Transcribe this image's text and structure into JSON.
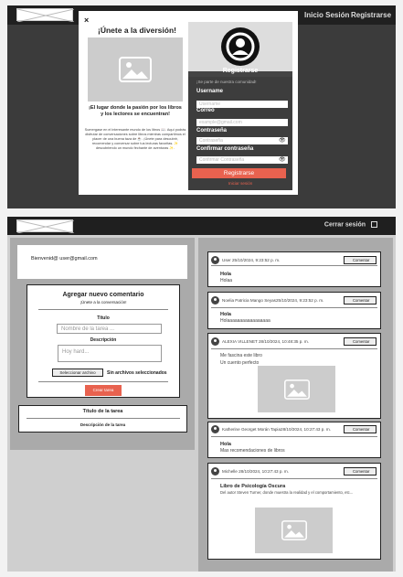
{
  "nav": {
    "login": "Inicio Sesión",
    "register": "Registrarse",
    "logout": "Cerrar sesión"
  },
  "modal": {
    "close": "×",
    "title": "¡Únete a la diversión!",
    "subtitle": "¡El lugar donde la pasión por los libros y los lectores se encuentran!",
    "description": "Sumergase en el interesante mundo de los libros 📖. Aquí podrás disfrutar de conversaciones sobre libros mientras compartimos el placer de una buena taza de ☕. ¡Únete para descubrir, recomendar y conversar sobre tus lecturas favoritas. ✨ descubriendo un mundo fechante de aventuras ✨."
  },
  "register": {
    "title": "Registrarse",
    "subtitle": "¡Se parte de nuestra comunidad!",
    "user_label": "Username",
    "user_placeholder": "Username",
    "email_label": "Correo",
    "email_placeholder": "example@gmail.com",
    "pass_label": "Contraseña",
    "pass_placeholder": "Contraseña",
    "confirm_label": "Confirmar contraseña",
    "confirm_placeholder": "Confirmar Contraseña",
    "submit": "Registrarse",
    "login_link": "Iniciar sesión"
  },
  "welcome": "Bienvenid@ user@gmail.com",
  "new_comment": {
    "title": "Agregar nuevo comentario",
    "subtitle": "¡Únete a la conversación!",
    "title_label": "Título",
    "title_placeholder": "Nombre de la tarea ...",
    "desc_label": "Descripción",
    "desc_placeholder": "Hoy hard...",
    "file_button": "Seleccionar archivo",
    "file_status": "Sin archivos seleccionados",
    "create": "Crear tarea"
  },
  "task": {
    "title": "Título de la tarea",
    "desc": "Descripción de la tarea"
  },
  "posts": [
    {
      "user": "User 25/10/2024, 9:23:52 p. m.",
      "title": "Hola",
      "body": "Holaa",
      "comment": "Comentar"
    },
    {
      "user": "Noelia Patricia Mango Seyas25/10/2024, 9:23:52 p. m.",
      "title": "Hola",
      "body": "Holaaaaaaaaaaaaaaaaa",
      "comment": "Comentar"
    },
    {
      "user": "ALEXIA VILLENET 28/10/2024, 10:48:35 p. m.",
      "title": "Me fascina este libro",
      "body": "Un cuento perfecto",
      "comment": "Comentar"
    },
    {
      "user": "Katherine Georget Morán Tapia28/10/2024, 10:27:43 p. m.",
      "title": "Hola",
      "body": "Mas recomendaciones de libros",
      "comment": "Comentar"
    },
    {
      "user": "Michelle 28/10/2024, 10:27:43 p. m.",
      "title": "Libro de Psicología Oscura",
      "body": "Del autor Steven Turner, donde muestra la realidad y el comportamiento, etc...",
      "comment": "Comentar"
    }
  ]
}
